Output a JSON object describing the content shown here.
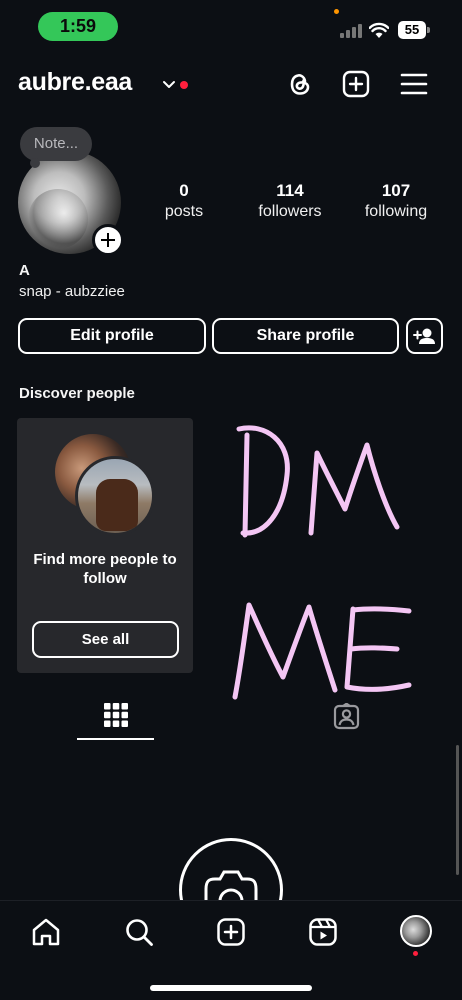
{
  "status_bar": {
    "time": "1:59",
    "battery": "55"
  },
  "header": {
    "username": "aubre.eaa"
  },
  "profile": {
    "note_placeholder": "Note...",
    "display_name": "A",
    "bio": "snap - aubzziee",
    "stats": [
      {
        "value": "0",
        "label": "posts"
      },
      {
        "value": "114",
        "label": "followers"
      },
      {
        "value": "107",
        "label": "following"
      }
    ]
  },
  "actions": {
    "edit_profile": "Edit profile",
    "share_profile": "Share profile"
  },
  "discover": {
    "title": "Discover people",
    "card_text": "Find more people to follow",
    "see_all": "See all"
  },
  "overlay_handwriting": [
    "DM",
    "ME"
  ],
  "icons": {
    "header": [
      "chevron-down-icon",
      "threads-icon",
      "new-post-icon",
      "menu-icon"
    ],
    "tabs": [
      "grid-icon",
      "tagged-icon"
    ],
    "nav": [
      "home-icon",
      "search-icon",
      "create-icon",
      "reels-icon",
      "profile-avatar"
    ]
  },
  "colors": {
    "background": "#0c0f14",
    "status_green": "#34c759",
    "notification_red": "#ff1f3d",
    "handwriting_pink": "#f4c6f4"
  }
}
